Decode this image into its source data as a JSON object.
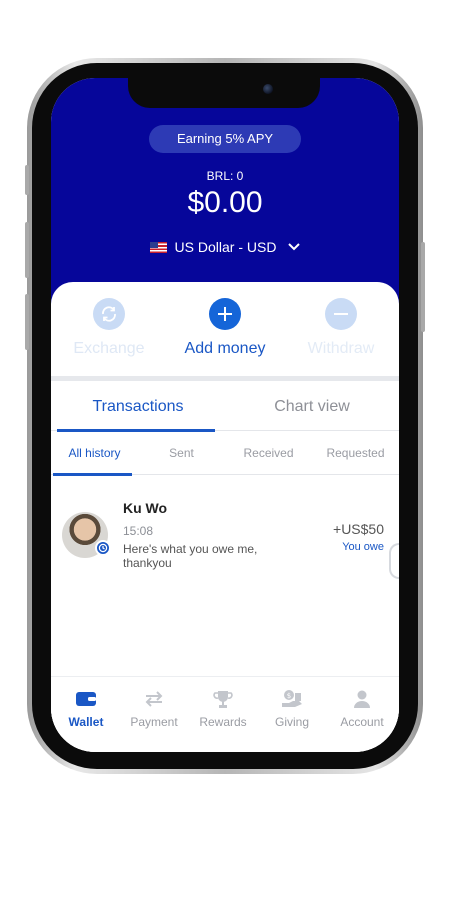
{
  "header": {
    "apy_label": "Earning 5%  APY",
    "secondary_balance": "BRL: 0",
    "balance": "$0.00",
    "currency": "US Dollar - USD",
    "background_color": "#06069a"
  },
  "actions": [
    {
      "label": "Exchange",
      "icon": "exchange-icon",
      "enabled": false
    },
    {
      "label": "Add money",
      "icon": "plus-icon",
      "enabled": true
    },
    {
      "label": "Withdraw",
      "icon": "minus-icon",
      "enabled": false
    }
  ],
  "tabs": [
    {
      "label": "Transactions",
      "active": true
    },
    {
      "label": "Chart view",
      "active": false
    }
  ],
  "subtabs": [
    {
      "label": "All history",
      "active": true
    },
    {
      "label": "Sent",
      "active": false
    },
    {
      "label": "Received",
      "active": false
    },
    {
      "label": "Requested",
      "active": false
    }
  ],
  "transactions": [
    {
      "name": "Ku Wo",
      "time": "15:08",
      "message": "Here's what you owe me, thankyou",
      "amount": "+US$50",
      "status": "You owe"
    }
  ],
  "bottom_nav": [
    {
      "label": "Wallet",
      "icon": "wallet-icon",
      "active": true
    },
    {
      "label": "Payment",
      "icon": "transfer-arrows-icon",
      "active": false
    },
    {
      "label": "Rewards",
      "icon": "trophy-icon",
      "active": false
    },
    {
      "label": "Giving",
      "icon": "donation-icon",
      "active": false
    },
    {
      "label": "Account",
      "icon": "person-icon",
      "active": false
    }
  ],
  "accent_color": "#1a57c5"
}
